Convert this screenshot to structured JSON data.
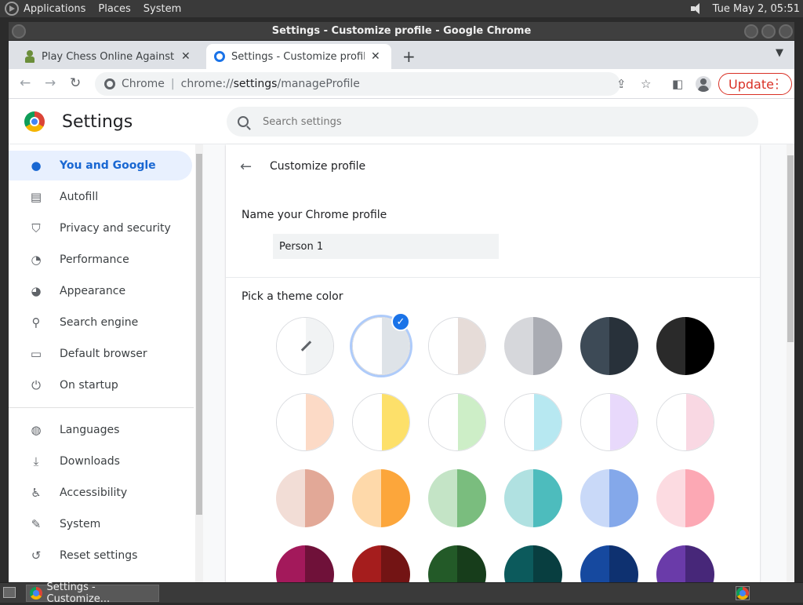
{
  "panel": {
    "menus": [
      "Applications",
      "Places",
      "System"
    ],
    "clock": "Tue May  2, 05:51"
  },
  "window": {
    "title": "Settings - Customize profile - Google Chrome"
  },
  "tabs": [
    {
      "title": "Play Chess Online Against the",
      "icon": "chess-pawn-icon"
    },
    {
      "title": "Settings - Customize profile",
      "icon": "gear-icon"
    }
  ],
  "toolbar": {
    "site_label": "Chrome",
    "url_prefix": "chrome://",
    "url_host": "settings",
    "url_path": "/manageProfile",
    "update_label": "Update"
  },
  "settings": {
    "title": "Settings",
    "search_placeholder": "Search settings"
  },
  "sidebar": {
    "items": [
      {
        "label": "You and Google",
        "icon": "person-icon",
        "active": true
      },
      {
        "label": "Autofill",
        "icon": "clipboard-icon"
      },
      {
        "label": "Privacy and security",
        "icon": "shield-icon"
      },
      {
        "label": "Performance",
        "icon": "speedometer-icon"
      },
      {
        "label": "Appearance",
        "icon": "palette-icon"
      },
      {
        "label": "Search engine",
        "icon": "search-icon"
      },
      {
        "label": "Default browser",
        "icon": "browser-icon"
      },
      {
        "label": "On startup",
        "icon": "power-icon"
      },
      {
        "label": "Languages",
        "icon": "globe-icon"
      },
      {
        "label": "Downloads",
        "icon": "download-icon"
      },
      {
        "label": "Accessibility",
        "icon": "accessibility-icon"
      },
      {
        "label": "System",
        "icon": "wrench-icon"
      },
      {
        "label": "Reset settings",
        "icon": "restore-icon"
      }
    ]
  },
  "profile": {
    "subpage_title": "Customize profile",
    "name_label": "Name your Chrome profile",
    "name_value": "Person 1",
    "theme_label": "Pick a theme color"
  },
  "theme_colors": [
    {
      "left": "#ffffff",
      "right": "#f1f3f4",
      "custom": true
    },
    {
      "left": "#ffffff",
      "right": "#dee3e8",
      "selected": true
    },
    {
      "left": "#ffffff",
      "right": "#e6dcd8"
    },
    {
      "left": "#d6d7db",
      "right": "#a9abb2"
    },
    {
      "left": "#3d4a56",
      "right": "#28313a"
    },
    {
      "left": "#2a2a2a",
      "right": "#000000"
    },
    {
      "left": "#ffffff",
      "right": "#fcdac6"
    },
    {
      "left": "#ffffff",
      "right": "#fde06a"
    },
    {
      "left": "#ffffff",
      "right": "#cdeec7"
    },
    {
      "left": "#ffffff",
      "right": "#b7e8f1"
    },
    {
      "left": "#ffffff",
      "right": "#e8d9fb"
    },
    {
      "left": "#ffffff",
      "right": "#f9d8e3"
    },
    {
      "left": "#f2ddd6",
      "right": "#e2a897"
    },
    {
      "left": "#fed9aa",
      "right": "#fca63b"
    },
    {
      "left": "#c4e4c6",
      "right": "#7abd7e"
    },
    {
      "left": "#b0e1e1",
      "right": "#4dbcbd"
    },
    {
      "left": "#c9d9f8",
      "right": "#84a8ea"
    },
    {
      "left": "#fcdbe1",
      "right": "#fca8b4"
    },
    {
      "left": "#a3195b",
      "right": "#6f1139"
    },
    {
      "left": "#a51d1d",
      "right": "#731414"
    },
    {
      "left": "#235a28",
      "right": "#173d1b"
    },
    {
      "left": "#0c5a5c",
      "right": "#083e40"
    },
    {
      "left": "#16499f",
      "right": "#0e3170"
    },
    {
      "left": "#6a3ba9",
      "right": "#472779"
    }
  ],
  "taskbar": {
    "task_label": "Settings - Customize..."
  },
  "colors": {
    "accent": "#1a73e8",
    "update": "#d93025",
    "active_bg": "#e8f0fe"
  }
}
